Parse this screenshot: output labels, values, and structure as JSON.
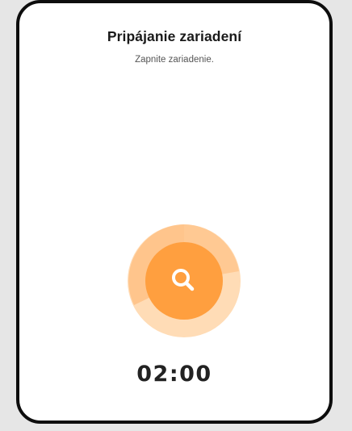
{
  "screen": {
    "title": "Pripájanie zariadení",
    "subtitle": "Zapnite zariadenie.",
    "timer": "02:00"
  },
  "search_button": {
    "icon": "search-icon"
  },
  "colors": {
    "accent": "#ff9f3f",
    "ring_light": "#ffdcb6",
    "ring_mid": "#ffc58c"
  }
}
